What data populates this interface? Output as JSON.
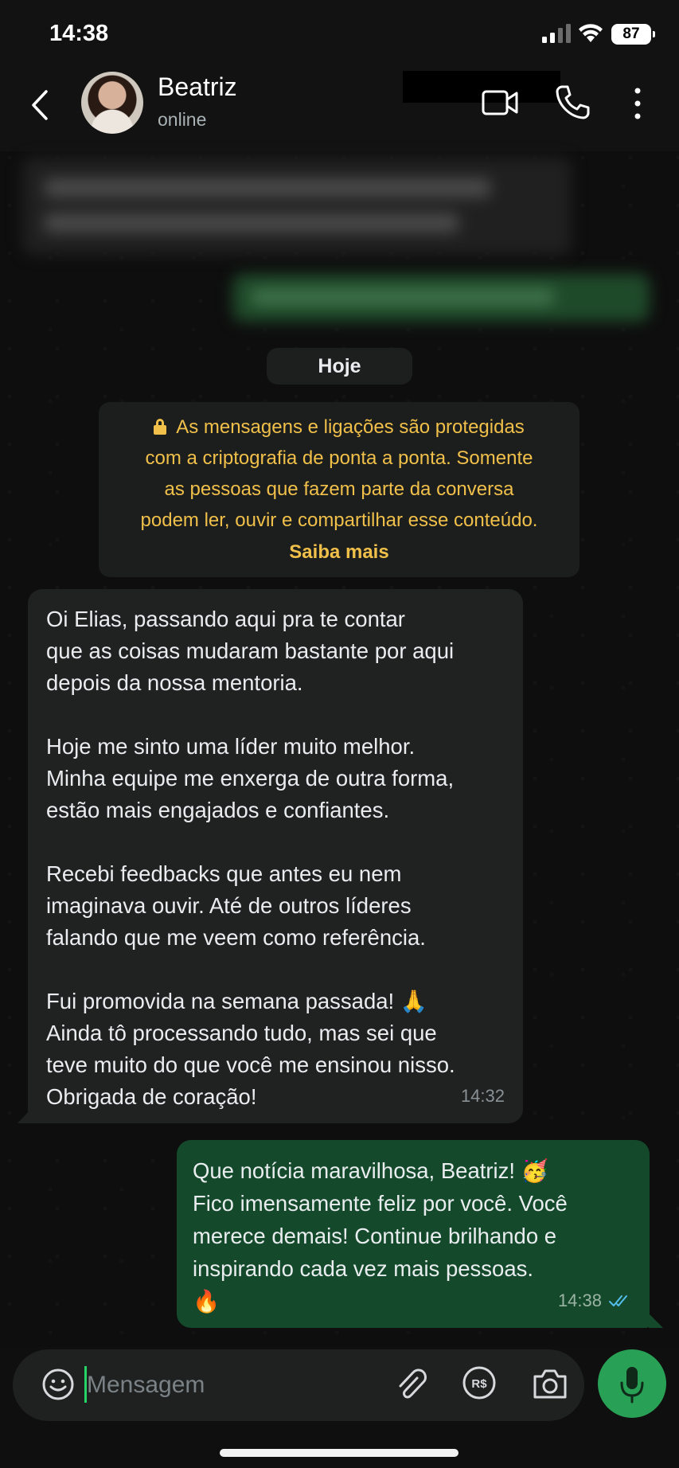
{
  "status_bar": {
    "time": "14:38",
    "battery": "87",
    "icons": [
      "signal-icon",
      "wifi-icon",
      "battery-icon"
    ]
  },
  "header": {
    "contact_name": "Beatriz",
    "contact_status": "online",
    "icons": [
      "back-icon",
      "video-call-icon",
      "phone-icon",
      "more-vertical-icon"
    ]
  },
  "chat": {
    "date_chip": "Hoje",
    "encryption_notice": {
      "text": "As mensagens e ligações são protegidas\ncom a criptografia de ponta a ponta. Somente\nas pessoas que fazem parte da conversa\npodem ler, ouvir e compartilhar esse conteúdo.",
      "learn_more": "Saiba mais",
      "icon": "lock-icon"
    },
    "messages": [
      {
        "direction": "incoming",
        "paragraphs": [
          "Oi Elias, passando aqui pra te contar\nque as coisas mudaram bastante por aqui\ndepois da nossa mentoria.",
          "Hoje me sinto uma líder muito melhor.\nMinha equipe me enxerga de outra forma,\nestão mais engajados e confiantes.",
          "Recebi feedbacks que antes eu nem\nimaginava ouvir. Até de outros líderes\nfalando que me veem como referência.",
          "Fui promovida na semana passada! 🙏\nAinda tô processando tudo, mas sei que\nteve muito do que você me ensinou nisso.\nObrigada de coração!"
        ],
        "time": "14:32"
      },
      {
        "direction": "outgoing",
        "text": "Que notícia maravilhosa, Beatriz! 🥳\nFico imensamente feliz por você. Você\nmerece demais! Continue brilhando e\ninspirando cada vez mais pessoas.\n🔥",
        "time": "14:38",
        "status": "read",
        "status_icon": "double-check-icon"
      }
    ]
  },
  "composer": {
    "placeholder": "Mensagem",
    "icons": [
      "emoji-icon",
      "attach-icon",
      "pix-icon",
      "camera-icon",
      "mic-icon"
    ]
  },
  "colors": {
    "background": "#0e0e0e",
    "incoming_bubble": "#202222",
    "outgoing_bubble": "#144a2b",
    "notice_text": "#f0c04a",
    "accent_green": "#28a055",
    "read_ticks": "#53bdeb"
  }
}
